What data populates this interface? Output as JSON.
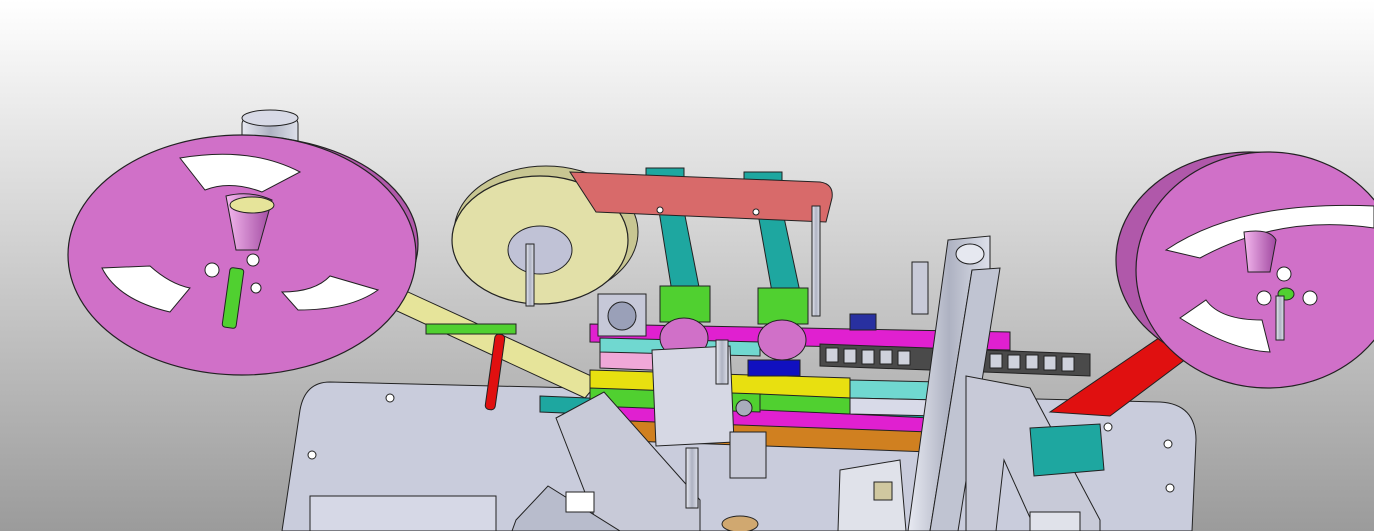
{
  "scene": {
    "colors": {
      "background_top": "#ffffff",
      "background_bottom": "#9b9b9b",
      "reel": "#d070c8",
      "reel_dark": "#b058aa",
      "tape": "#e6e49a",
      "cover_tape_roll": "#e2e0a8",
      "base_plate": "#c9ccdc",
      "pink_bar": "#d86a6a",
      "teal": "#1ea7a0",
      "magenta": "#e020d0",
      "yellow": "#e8e010",
      "green": "#50d030",
      "cyan": "#70d8d0",
      "red": "#e01010",
      "steel": "#c0c4d2",
      "orange": "#d08020"
    }
  }
}
